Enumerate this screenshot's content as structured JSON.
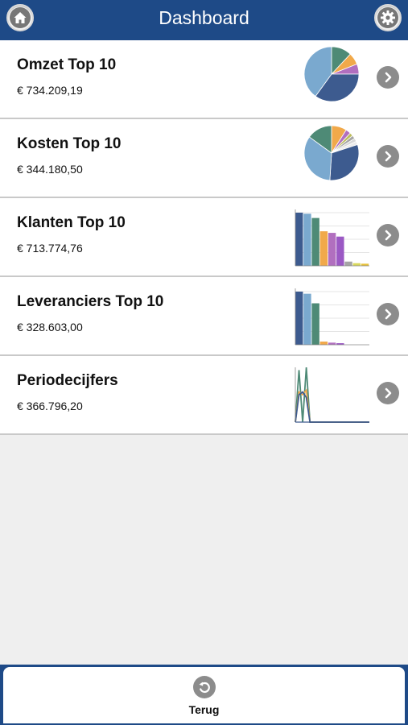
{
  "header": {
    "title": "Dashboard",
    "home_icon": "home-icon",
    "settings_icon": "gear-icon",
    "color": "#1e4a87"
  },
  "rows": [
    {
      "title": "Omzet Top 10",
      "amount": "€ 734.209,19",
      "chart_type": "pie",
      "slices": [
        {
          "value": 12,
          "color": "#4e8a76"
        },
        {
          "value": 7,
          "color": "#f1a94a"
        },
        {
          "value": 6,
          "color": "#b16fbf"
        },
        {
          "value": 35,
          "color": "#3d5b8f"
        },
        {
          "value": 40,
          "color": "#7aa9cf"
        }
      ]
    },
    {
      "title": "Kosten Top 10",
      "amount": "€ 344.180,50",
      "chart_type": "pie",
      "slices": [
        {
          "value": 9,
          "color": "#f1a94a"
        },
        {
          "value": 3,
          "color": "#b16fbf"
        },
        {
          "value": 2,
          "color": "#bdbd5c"
        },
        {
          "value": 2,
          "color": "#a5a5a5"
        },
        {
          "value": 2,
          "color": "#d8d8d8"
        },
        {
          "value": 2,
          "color": "#ececec"
        },
        {
          "value": 31,
          "color": "#3d5b8f"
        },
        {
          "value": 34,
          "color": "#7aa9cf"
        },
        {
          "value": 15,
          "color": "#4e8a76"
        }
      ]
    },
    {
      "title": "Klanten Top 10",
      "amount": "€ 713.774,76",
      "chart_type": "bar",
      "bars": [
        {
          "value": 100,
          "color": "#3d5b8f"
        },
        {
          "value": 98,
          "color": "#7aa9cf"
        },
        {
          "value": 90,
          "color": "#4e8a76"
        },
        {
          "value": 65,
          "color": "#f1a94a"
        },
        {
          "value": 62,
          "color": "#b16fbf"
        },
        {
          "value": 55,
          "color": "#9b59c4"
        },
        {
          "value": 8,
          "color": "#a5a5a5"
        },
        {
          "value": 5,
          "color": "#d8d85c"
        },
        {
          "value": 4,
          "color": "#e8c23a"
        }
      ]
    },
    {
      "title": "Leveranciers Top 10",
      "amount": "€ 328.603,00",
      "chart_type": "bar",
      "bars": [
        {
          "value": 100,
          "color": "#3d5b8f"
        },
        {
          "value": 96,
          "color": "#7aa9cf"
        },
        {
          "value": 78,
          "color": "#4e8a76"
        },
        {
          "value": 6,
          "color": "#f1a94a"
        },
        {
          "value": 4,
          "color": "#b16fbf"
        },
        {
          "value": 3,
          "color": "#9b59c4"
        }
      ]
    },
    {
      "title": "Periodecijfers",
      "amount": "€ 366.796,20",
      "chart_type": "line",
      "series": [
        {
          "color": "#4e8a76",
          "values": [
            0,
            95,
            0,
            100,
            0,
            0,
            0,
            0,
            0,
            0
          ]
        },
        {
          "color": "#f1a94a",
          "values": [
            0,
            55,
            50,
            58,
            0,
            0,
            0,
            0,
            0,
            0
          ]
        },
        {
          "color": "#3d5b8f",
          "values": [
            0,
            50,
            55,
            45,
            0,
            0,
            0,
            0,
            0,
            0
          ]
        }
      ]
    }
  ],
  "footer": {
    "back_label": "Terug",
    "back_icon": "undo-icon"
  },
  "icons": {
    "chevron": "chevron-right-icon"
  }
}
